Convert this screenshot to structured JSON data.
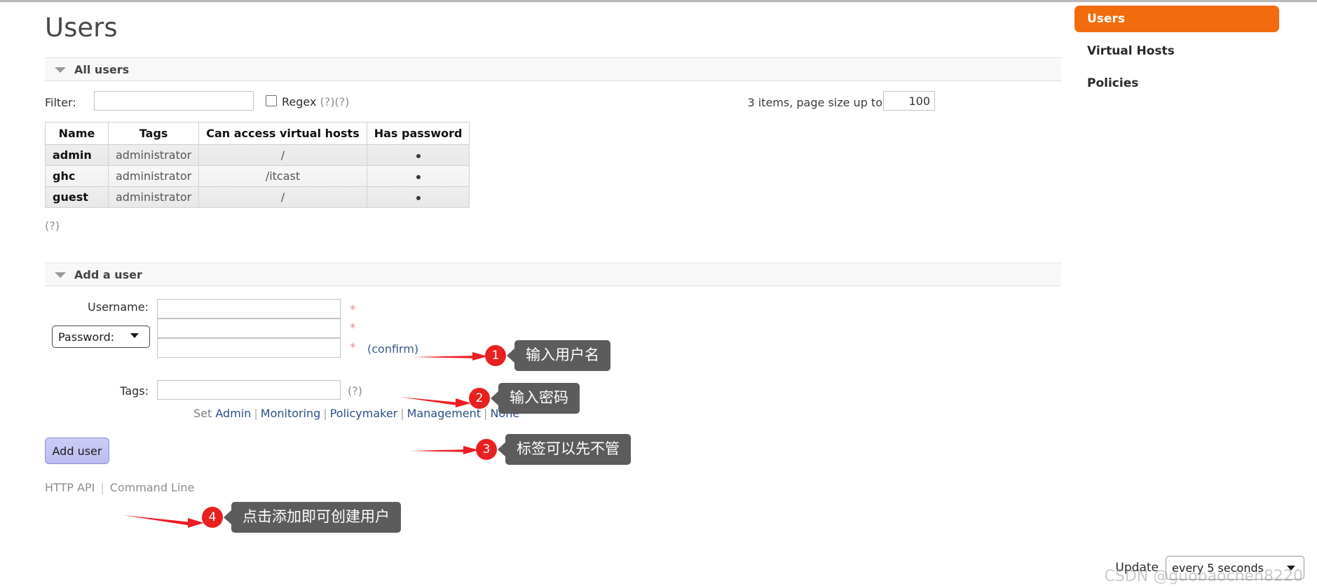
{
  "page": {
    "title": "Users"
  },
  "sidebar": {
    "items": [
      {
        "label": "Users",
        "active": true
      },
      {
        "label": "Virtual Hosts",
        "active": false
      },
      {
        "label": "Policies",
        "active": false
      }
    ],
    "active_color": "#f26c0d"
  },
  "all_users_section": {
    "header": "All users",
    "filter_label": "Filter:",
    "filter_value": "",
    "filter_placeholder": "",
    "regex_label": "Regex (?)(?)",
    "regex_checked": false,
    "items_summary": "3 items, page size up to",
    "page_size": "100",
    "help_marker": "(?)",
    "table": {
      "columns": [
        "Name",
        "Tags",
        "Can access virtual hosts",
        "Has password"
      ],
      "rows": [
        {
          "name": "admin",
          "tags": "administrator",
          "vhosts": "/",
          "has_password": "●"
        },
        {
          "name": "ghc",
          "tags": "administrator",
          "vhosts": "/itcast",
          "has_password": "●"
        },
        {
          "name": "guest",
          "tags": "administrator",
          "vhosts": "/",
          "has_password": "●"
        }
      ]
    }
  },
  "add_user_section": {
    "header": "Add a user",
    "username_label": "Username:",
    "username_value": "",
    "username_required": "*",
    "password_select_label": "Password:",
    "password_value": "",
    "password_required": "*",
    "password_confirm_value": "",
    "password_confirm_required": "*",
    "password_confirm_text": "(confirm)",
    "tags_label": "Tags:",
    "tags_value": "",
    "tags_help": "(?)",
    "tag_set_word": "Set",
    "tag_links": [
      "Admin",
      "Monitoring",
      "Policymaker",
      "Management",
      "None"
    ],
    "add_button": "Add user"
  },
  "footer": {
    "links": [
      "HTTP API",
      "Command Line"
    ]
  },
  "update_bar": {
    "label": "Update",
    "selected": "every 5 seconds"
  },
  "watermark": "CSDN @guobaochen8220",
  "annotations": [
    {
      "num": "1",
      "text": "输入用户名"
    },
    {
      "num": "2",
      "text": "输入密码"
    },
    {
      "num": "3",
      "text": "标签可以先不管"
    },
    {
      "num": "4",
      "text": "点击添加即可创建用户"
    }
  ],
  "annotation_color": "#e8201f"
}
